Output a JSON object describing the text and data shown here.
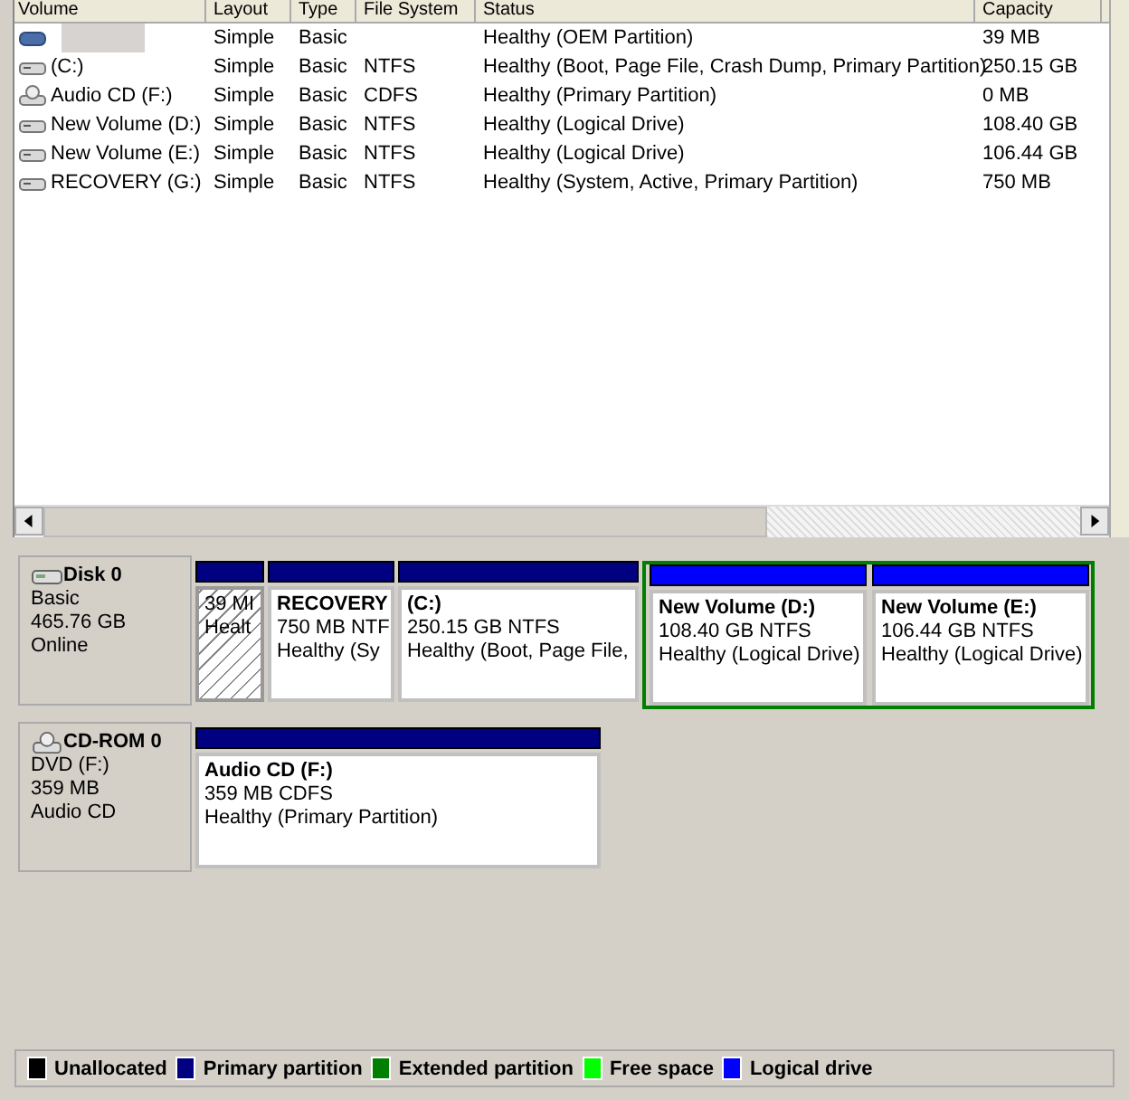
{
  "table": {
    "columns": [
      "Volume",
      "Layout",
      "Type",
      "File System",
      "Status",
      "Capacity"
    ],
    "rows": [
      {
        "kind": "oem",
        "redacted": true,
        "cells": [
          "",
          "Simple",
          "Basic",
          "",
          "Healthy (OEM Partition)",
          "39 MB"
        ]
      },
      {
        "kind": "hdd",
        "redacted": false,
        "cells": [
          "(C:)",
          "Simple",
          "Basic",
          "NTFS",
          "Healthy (Boot, Page File, Crash Dump, Primary Partition)",
          "250.15 GB"
        ]
      },
      {
        "kind": "cd",
        "redacted": false,
        "cells": [
          "Audio CD (F:)",
          "Simple",
          "Basic",
          "CDFS",
          "Healthy (Primary Partition)",
          "0 MB"
        ]
      },
      {
        "kind": "hdd",
        "redacted": false,
        "cells": [
          "New Volume (D:)",
          "Simple",
          "Basic",
          "NTFS",
          "Healthy (Logical Drive)",
          "108.40 GB"
        ]
      },
      {
        "kind": "hdd",
        "redacted": false,
        "cells": [
          "New Volume (E:)",
          "Simple",
          "Basic",
          "NTFS",
          "Healthy (Logical Drive)",
          "106.44 GB"
        ]
      },
      {
        "kind": "hdd",
        "redacted": false,
        "cells": [
          "RECOVERY (G:)",
          "Simple",
          "Basic",
          "NTFS",
          "Healthy (System, Active, Primary Partition)",
          "750 MB"
        ]
      }
    ]
  },
  "disks": [
    {
      "kind": "hdd",
      "name": "Disk 0",
      "lines": [
        "Basic",
        "465.76 GB",
        "Online"
      ],
      "partitions": [
        {
          "kind": "primary",
          "selected": true,
          "lines": [
            "39 MI",
            "Healt"
          ]
        },
        {
          "kind": "primary",
          "selected": false,
          "title": "RECOVERY",
          "lines": [
            "750 MB NTF",
            "Healthy (Sy"
          ]
        },
        {
          "kind": "primary",
          "selected": false,
          "title": "(C:)",
          "lines": [
            "250.15 GB NTFS",
            "Healthy (Boot, Page File,"
          ]
        },
        {
          "kind": "extended",
          "children": [
            {
              "kind": "logical",
              "selected": false,
              "title": "New Volume  (D:)",
              "lines": [
                "108.40 GB NTFS",
                "Healthy (Logical Drive)"
              ]
            },
            {
              "kind": "logical",
              "selected": false,
              "title": "New Volume  (E:)",
              "lines": [
                "106.44 GB NTFS",
                "Healthy (Logical Drive)"
              ]
            }
          ]
        }
      ]
    },
    {
      "kind": "cd",
      "name": "CD-ROM 0",
      "lines": [
        "DVD (F:)",
        "359 MB",
        "Audio CD"
      ],
      "partitions": [
        {
          "kind": "primary",
          "selected": false,
          "title": "Audio CD  (F:)",
          "lines": [
            "359 MB CDFS",
            "Healthy (Primary Partition)"
          ]
        }
      ]
    }
  ],
  "legend": [
    {
      "label": "Unallocated",
      "color": "#000000"
    },
    {
      "label": "Primary partition",
      "color": "#000080"
    },
    {
      "label": "Extended partition",
      "color": "#008000"
    },
    {
      "label": "Free space",
      "color": "#00ff00"
    },
    {
      "label": "Logical drive",
      "color": "#0000ff"
    }
  ]
}
